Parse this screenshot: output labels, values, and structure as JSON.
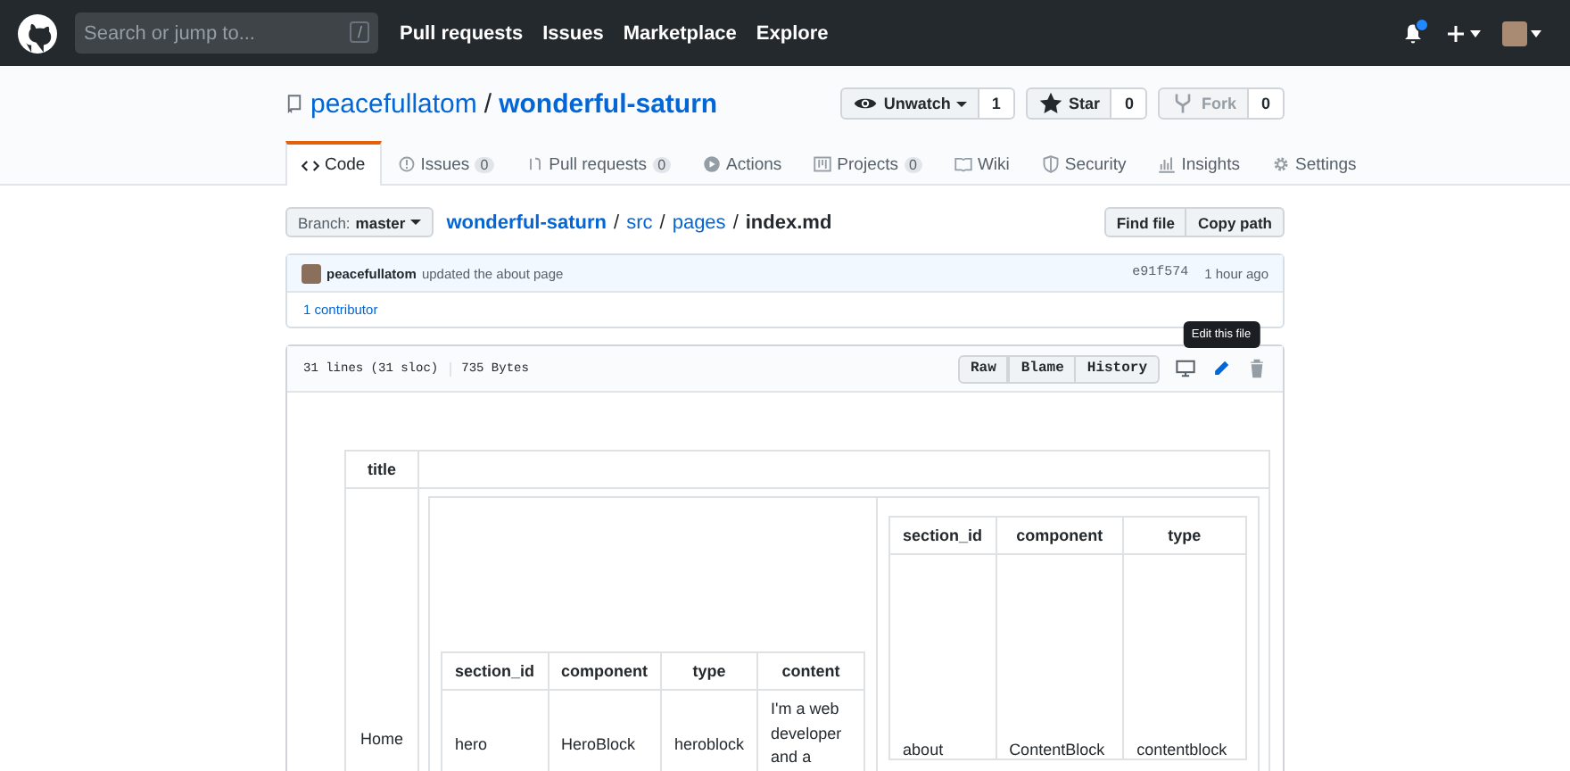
{
  "header": {
    "search_placeholder": "Search or jump to...",
    "search_key": "/",
    "nav": [
      "Pull requests",
      "Issues",
      "Marketplace",
      "Explore"
    ],
    "notifications_unread": true
  },
  "repo": {
    "owner": "peacefullatom",
    "separator": "/",
    "name": "wonderful-saturn",
    "actions": [
      {
        "kind": "watch",
        "label": "Unwatch",
        "count": "1",
        "disabled": false
      },
      {
        "kind": "star",
        "label": "Star",
        "count": "0",
        "disabled": false
      },
      {
        "kind": "fork",
        "label": "Fork",
        "count": "0",
        "disabled": true
      }
    ]
  },
  "tabs": [
    {
      "kind": "code",
      "label": "Code",
      "selected": true
    },
    {
      "kind": "issues",
      "label": "Issues",
      "count": "0",
      "selected": false
    },
    {
      "kind": "pulls",
      "label": "Pull requests",
      "count": "0",
      "selected": false
    },
    {
      "kind": "actions",
      "label": "Actions",
      "selected": false
    },
    {
      "kind": "projects",
      "label": "Projects",
      "count": "0",
      "selected": false
    },
    {
      "kind": "wiki",
      "label": "Wiki",
      "selected": false
    },
    {
      "kind": "security",
      "label": "Security",
      "selected": false
    },
    {
      "kind": "insights",
      "label": "Insights",
      "selected": false
    },
    {
      "kind": "settings",
      "label": "Settings",
      "selected": false
    }
  ],
  "file_nav": {
    "branch_label": "Branch:",
    "branch": "master",
    "path": [
      "wonderful-saturn",
      "src",
      "pages"
    ],
    "separators": [
      "/",
      "/",
      "/"
    ],
    "file": "index.md",
    "buttons": [
      "Find file",
      "Copy path"
    ]
  },
  "commit": {
    "author": "peacefullatom",
    "message": "updated the about page",
    "sha": "e91f574",
    "time": "1 hour ago",
    "contributors": "1 contributor"
  },
  "file_header": {
    "lines": "31 lines (31 sloc)",
    "size": "735 Bytes",
    "buttons": [
      "Raw",
      "Blame",
      "History"
    ],
    "tooltip": "Edit this file"
  },
  "table": {
    "columns": [
      "title"
    ],
    "rows": [
      {
        "title": "Home",
        "sections": [
          {
            "columns": [
              "section_id",
              "component",
              "type",
              "content"
            ],
            "rows": [
              [
                "hero",
                "HeroBlock",
                "heroblock",
                "I'm a web developer and a"
              ]
            ]
          },
          {
            "columns": [
              "section_id",
              "component",
              "type"
            ],
            "rows": [
              [
                "about",
                "ContentBlock",
                "contentblock"
              ]
            ]
          }
        ]
      }
    ]
  }
}
